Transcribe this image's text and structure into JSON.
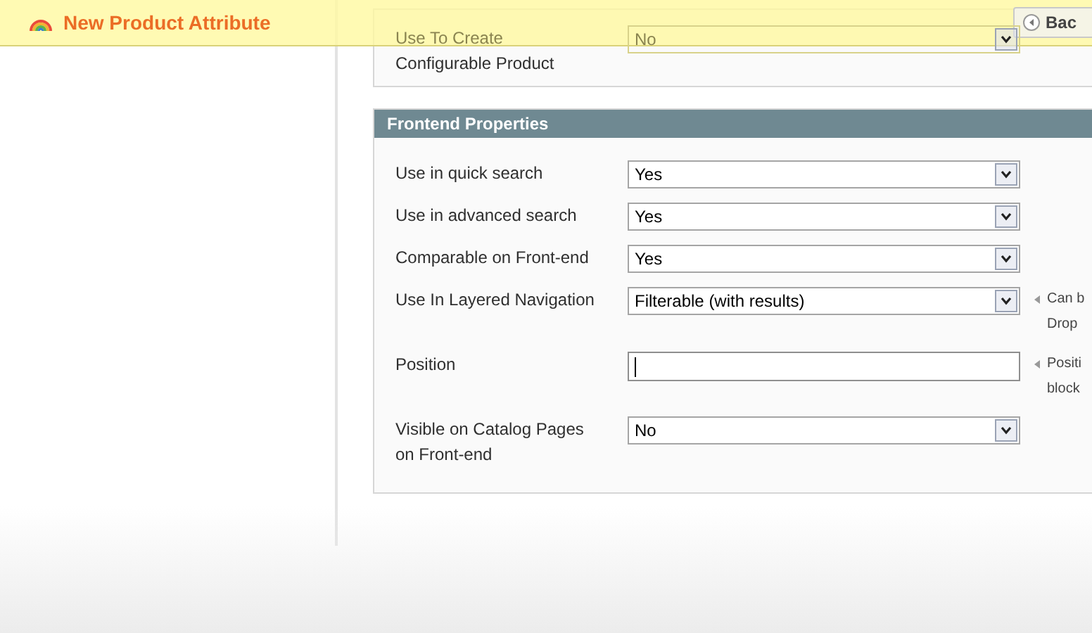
{
  "title_bar": {
    "title": "New Product Attribute"
  },
  "back_button": {
    "label": "Bac"
  },
  "top_field": {
    "label_lines": [
      "Use To Create",
      "Configurable Product"
    ],
    "kind": "select",
    "value": "No"
  },
  "section": {
    "title": "Frontend Properties",
    "fields": [
      {
        "kind": "select",
        "label_lines": [
          "Use in quick search"
        ],
        "value": "Yes"
      },
      {
        "kind": "select",
        "label_lines": [
          "Use in advanced search"
        ],
        "value": "Yes"
      },
      {
        "kind": "select",
        "label_lines": [
          "Comparable on Front-end"
        ],
        "value": "Yes"
      },
      {
        "kind": "select",
        "label_lines": [
          "Use In Layered Navigation"
        ],
        "value": "Filterable (with results)",
        "hint_lines": [
          "Can b",
          "Drop"
        ]
      },
      {
        "kind": "text",
        "label_lines": [
          "Position"
        ],
        "focused": true,
        "hint_lines": [
          "Positi",
          "block"
        ]
      },
      {
        "kind": "select",
        "label_lines": [
          "Visible on Catalog Pages",
          "on Front-end"
        ],
        "value": "No"
      }
    ]
  }
}
